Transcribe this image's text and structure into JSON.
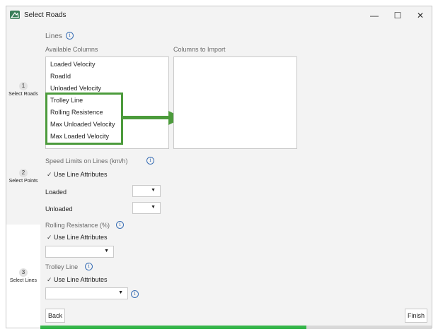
{
  "window": {
    "title": "Select Roads",
    "minimize_glyph": "—",
    "maximize_glyph": "☐",
    "close_glyph": "✕"
  },
  "steps": [
    {
      "number": "1",
      "label": "Select Roads"
    },
    {
      "number": "2",
      "label": "Select Points"
    },
    {
      "number": "3",
      "label": "Select Lines"
    }
  ],
  "lines": {
    "heading": "Lines",
    "available_header": "Available Columns",
    "import_header": "Columns to Import",
    "available_items": [
      "Loaded Velocity",
      "RoadId",
      "Unloaded Velocity",
      "Trolley Line",
      "Rolling Resistence",
      "Max Unloaded Velocity",
      "Max Loaded Velocity"
    ],
    "import_items": [],
    "highlight_color": "#4c9b3c"
  },
  "speed_limits": {
    "heading": "Speed Limits on Lines (km/h)",
    "use_line_attributes": "Use Line Attributes",
    "loaded_label": "Loaded",
    "unloaded_label": "Unloaded",
    "loaded_value": "",
    "unloaded_value": ""
  },
  "rolling_resistance": {
    "heading": "Rolling Resistance (%)",
    "use_line_attributes": "Use Line Attributes",
    "value": ""
  },
  "trolley_line": {
    "heading": "Trolley Line",
    "use_line_attributes": "Use Line Attributes",
    "value": ""
  },
  "buttons": {
    "back": "Back",
    "finish": "Finish"
  },
  "progress": {
    "fraction": 0.68,
    "color": "#35b54a"
  },
  "icons": {
    "info": "info-icon",
    "check": "checkmark-icon",
    "caret": "caret-down-icon",
    "arrow": "arrow-right-icon"
  }
}
